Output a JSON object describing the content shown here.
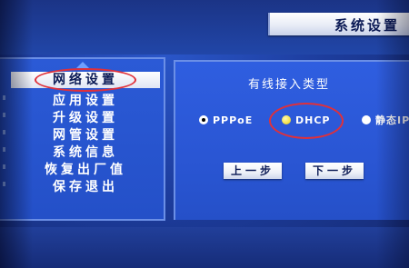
{
  "header": {
    "title": "系统设置"
  },
  "sidebar": {
    "items": [
      {
        "label": "网络设置",
        "selected": true
      },
      {
        "label": "应用设置",
        "selected": false
      },
      {
        "label": "升级设置",
        "selected": false
      },
      {
        "label": "网管设置",
        "selected": false
      },
      {
        "label": "系统信息",
        "selected": false
      },
      {
        "label": "恢复出厂值",
        "selected": false
      },
      {
        "label": "保存退出",
        "selected": false
      }
    ],
    "scroll_icon": "chevron-up-icon"
  },
  "panel": {
    "title": "有线接入类型",
    "options": [
      {
        "label": "PPPoE",
        "state": "focused"
      },
      {
        "label": "DHCP",
        "state": "selected"
      },
      {
        "label": "静态IP",
        "state": "unselected"
      }
    ],
    "prev_button": "上一步",
    "next_button": "下一步"
  },
  "annotations": {
    "color": "#e0303a"
  }
}
